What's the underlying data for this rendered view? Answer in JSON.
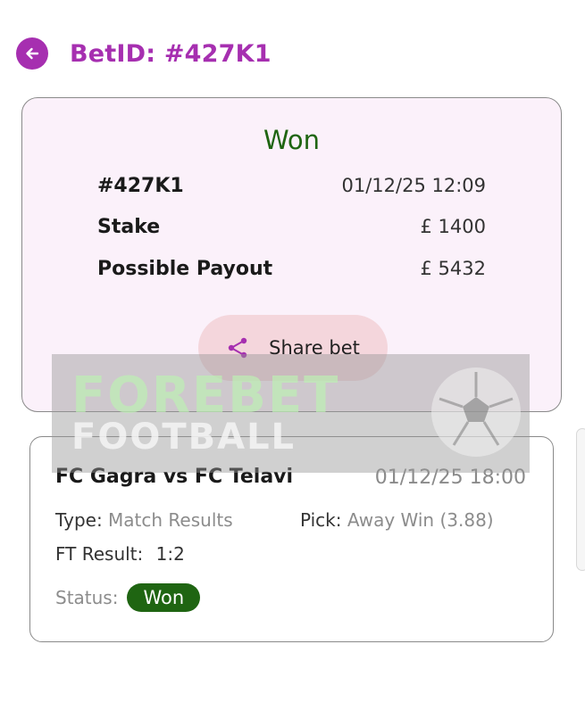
{
  "header": {
    "back_icon": "arrow-left-icon",
    "title": "BetID: #427K1",
    "accent": "#a62fb0"
  },
  "summary": {
    "result": "Won",
    "result_color": "#1f6512",
    "bet_id": "#427K1",
    "datetime": "01/12/25 12:09",
    "stake_label": "Stake",
    "stake_value": "£ 1400",
    "payout_label": "Possible Payout",
    "payout_value": "£ 5432",
    "share_label": "Share bet",
    "share_icon": "share-icon"
  },
  "watermark": {
    "line1": "FOREBET",
    "line2": "FOOTBALL"
  },
  "match": {
    "title": "FC Gagra  vs FC Telavi",
    "date": "01/12/25 18:00",
    "type_label": "Type:",
    "type_value": "Match Results",
    "pick_label": "Pick:",
    "pick_value": "Away Win (3.88)",
    "ft_label": "FT Result:",
    "ft_value": "1:2",
    "status_label": "Status:",
    "status_value": "Won"
  }
}
